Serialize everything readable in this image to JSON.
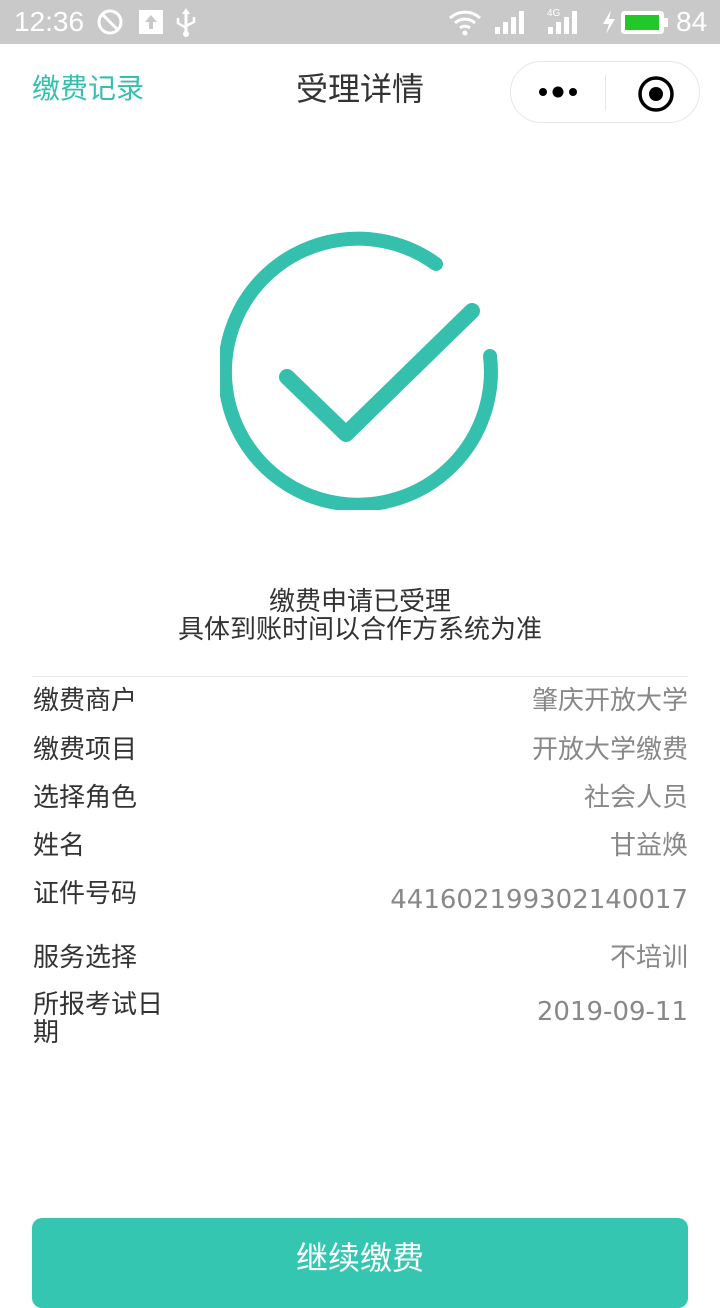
{
  "status_bar": {
    "time": "12:36",
    "battery": "84",
    "network": "4G",
    "icons": [
      "do-not-disturb-icon",
      "upload-icon",
      "usb-icon",
      "wifi-icon",
      "signal-icon",
      "signal-4g-icon",
      "charging-icon",
      "battery-icon"
    ]
  },
  "nav": {
    "left_link": "缴费记录",
    "title": "受理详情",
    "capsule_icons": [
      "more-icon",
      "close-miniprogram-icon"
    ]
  },
  "result": {
    "icon": "success-check-icon",
    "message_line1": "缴费申请已受理",
    "message_line2": "具体到账时间以合作方系统为准"
  },
  "details": [
    {
      "label": "缴费商户",
      "value": "肇庆开放大学"
    },
    {
      "label": "缴费项目",
      "value": "开放大学缴费"
    },
    {
      "label": "选择角色",
      "value": "社会人员"
    },
    {
      "label": "姓名",
      "value": "甘益焕"
    },
    {
      "label": "证件号码",
      "value": "441602199302140017"
    },
    {
      "label": "服务选择",
      "value": "不培训"
    },
    {
      "label": "所报考试日期",
      "value": "2019-09-11"
    }
  ],
  "button": {
    "label": "继续缴费"
  },
  "colors": {
    "accent": "#35c0ad",
    "button": "#35c6b2",
    "status_bar": "#c9c9c9"
  }
}
